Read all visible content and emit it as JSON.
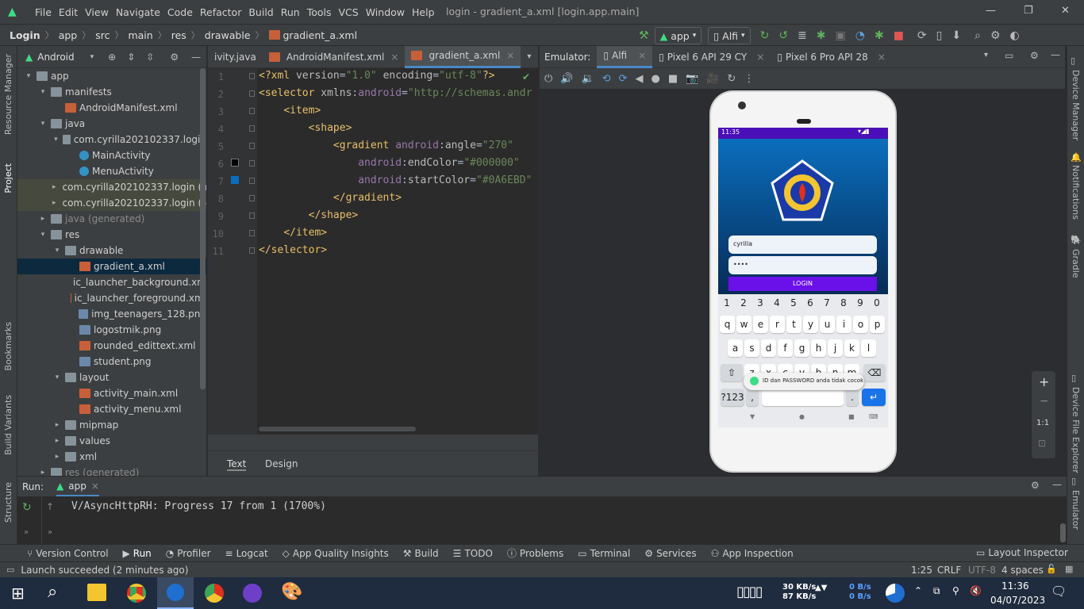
{
  "menu": [
    "File",
    "Edit",
    "View",
    "Navigate",
    "Code",
    "Refactor",
    "Build",
    "Run",
    "Tools",
    "VCS",
    "Window",
    "Help"
  ],
  "window_title": "login - gradient_a.xml [login.app.main]",
  "breadcrumb": [
    "Login",
    "app",
    "src",
    "main",
    "res",
    "drawable",
    "gradient_a.xml"
  ],
  "toolbar": {
    "run_config": "app",
    "device": "Alfi"
  },
  "left_stripe": [
    "Resource Manager",
    "Project",
    "Bookmarks",
    "Build Variants",
    "Structure"
  ],
  "right_stripe": [
    "Device Manager",
    "Notifications",
    "Gradle",
    "Device File Explorer",
    "Emulator"
  ],
  "project": {
    "view": "Android",
    "tree": [
      {
        "label": "app",
        "indent": 0,
        "type": "folder",
        "arrow": "▾"
      },
      {
        "label": "manifests",
        "indent": 1,
        "type": "folder",
        "arrow": "▾"
      },
      {
        "label": "AndroidManifest.xml",
        "indent": 2,
        "type": "xml",
        "arrow": ""
      },
      {
        "label": "java",
        "indent": 1,
        "type": "folder",
        "arrow": "▾"
      },
      {
        "label": "com.cyrilla202102337.login",
        "indent": 2,
        "type": "folder",
        "arrow": "▾"
      },
      {
        "label": "MainActivity",
        "indent": 3,
        "type": "class",
        "arrow": ""
      },
      {
        "label": "MenuActivity",
        "indent": 3,
        "type": "class",
        "arrow": ""
      },
      {
        "label": "com.cyrilla202102337.login (an",
        "indent": 2,
        "type": "folder",
        "arrow": "▸",
        "hl": true
      },
      {
        "label": "com.cyrilla202102337.login (te",
        "indent": 2,
        "type": "folder",
        "arrow": "▸",
        "hl": true
      },
      {
        "label": "java (generated)",
        "indent": 1,
        "type": "folder",
        "arrow": "▸"
      },
      {
        "label": "res",
        "indent": 1,
        "type": "folder",
        "arrow": "▾"
      },
      {
        "label": "drawable",
        "indent": 2,
        "type": "folder",
        "arrow": "▾"
      },
      {
        "label": "gradient_a.xml",
        "indent": 3,
        "type": "xml",
        "arrow": "",
        "sel": true
      },
      {
        "label": "ic_launcher_background.xml",
        "indent": 3,
        "type": "xml",
        "arrow": ""
      },
      {
        "label": "ic_launcher_foreground.xml",
        "indent": 3,
        "type": "xml",
        "arrow": ""
      },
      {
        "label": "img_teenagers_128.png",
        "indent": 3,
        "type": "png",
        "arrow": ""
      },
      {
        "label": "logostmik.png",
        "indent": 3,
        "type": "png",
        "arrow": ""
      },
      {
        "label": "rounded_edittext.xml",
        "indent": 3,
        "type": "xml",
        "arrow": ""
      },
      {
        "label": "student.png",
        "indent": 3,
        "type": "png",
        "arrow": ""
      },
      {
        "label": "layout",
        "indent": 2,
        "type": "folder",
        "arrow": "▾"
      },
      {
        "label": "activity_main.xml",
        "indent": 3,
        "type": "xml",
        "arrow": ""
      },
      {
        "label": "activity_menu.xml",
        "indent": 3,
        "type": "xml",
        "arrow": ""
      },
      {
        "label": "mipmap",
        "indent": 2,
        "type": "folder",
        "arrow": "▸"
      },
      {
        "label": "values",
        "indent": 2,
        "type": "folder",
        "arrow": "▸"
      },
      {
        "label": "xml",
        "indent": 2,
        "type": "folder",
        "arrow": "▸"
      },
      {
        "label": "res (generated)",
        "indent": 1,
        "type": "folder",
        "arrow": "▸"
      }
    ]
  },
  "editor": {
    "tabs": [
      "ivity.java",
      "AndroidManifest.xml",
      "gradient_a.xml"
    ],
    "active_tab": 2,
    "lines": [
      "1",
      "2",
      "3",
      "4",
      "5",
      "6",
      "7",
      "8",
      "9",
      "10",
      "11"
    ],
    "bottom_tabs": [
      "Text",
      "Design"
    ],
    "swatches": [
      "#000000",
      "#0A6EBD"
    ]
  },
  "emulator": {
    "label": "Emulator:",
    "tabs": [
      "Alfi",
      "Pixel 6 API 29 CY",
      "Pixel 6 Pro API 28"
    ],
    "phone": {
      "time": "11:35",
      "username": "cyrilla",
      "password": "••••",
      "login_button": "LOGIN",
      "number_row": [
        "1",
        "2",
        "3",
        "4",
        "5",
        "6",
        "7",
        "8",
        "9",
        "0"
      ],
      "row1": [
        "q",
        "w",
        "e",
        "r",
        "t",
        "y",
        "u",
        "i",
        "o",
        "p"
      ],
      "row2": [
        "a",
        "s",
        "d",
        "f",
        "g",
        "h",
        "j",
        "k",
        "l"
      ],
      "row3": [
        "z",
        "x",
        "c",
        "v",
        "b",
        "n",
        "m"
      ],
      "sym_key": "?123",
      "comma": ",",
      "period": ".",
      "toast": "ID dan PASSWORD anda tidak cocok"
    },
    "zoom_label": "1:1"
  },
  "run": {
    "label": "Run:",
    "config": "app",
    "log": "V/AsyncHttpRH: Progress 17 from 1 (1700%)"
  },
  "tool_windows": [
    "Version Control",
    "Run",
    "Profiler",
    "Logcat",
    "App Quality Insights",
    "Build",
    "TODO",
    "Problems",
    "Terminal",
    "Services",
    "App Inspection"
  ],
  "layout_inspector": "Layout Inspector",
  "status": {
    "message": "Launch succeeded (2 minutes ago)",
    "position": "1:25",
    "line_sep": "CRLF",
    "encoding": "UTF-8",
    "indent": "4 spaces"
  },
  "taskbar": {
    "net_up": "30 KB/s",
    "net_down": "87 KB/s",
    "net2_up": "0 B/s",
    "net2_down": "0 B/s",
    "time": "11:36",
    "date": "04/07/2023"
  }
}
